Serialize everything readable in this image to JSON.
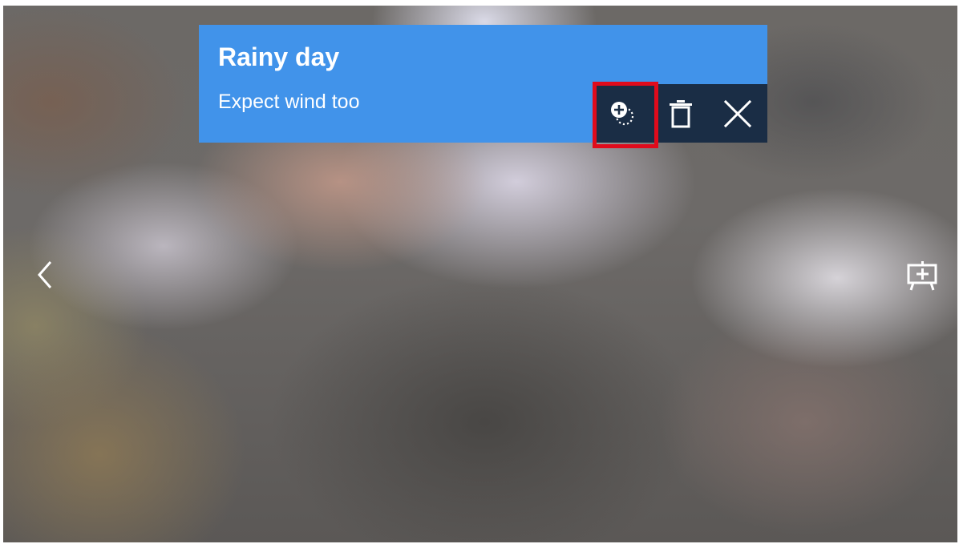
{
  "notification": {
    "title": "Rainy day",
    "subtitle": "Expect wind too",
    "background_color": "#4193ea",
    "actions": [
      {
        "name": "pin-to-board",
        "icon": "add-circle-dotted-icon",
        "highlighted": true
      },
      {
        "name": "delete",
        "icon": "trash-icon"
      },
      {
        "name": "close",
        "icon": "close-icon"
      }
    ],
    "action_bar_color": "#1a2d45",
    "highlight_color": "#e00b1c"
  },
  "navigation": {
    "back_icon": "chevron-left-icon",
    "board_icon": "board-add-icon"
  }
}
